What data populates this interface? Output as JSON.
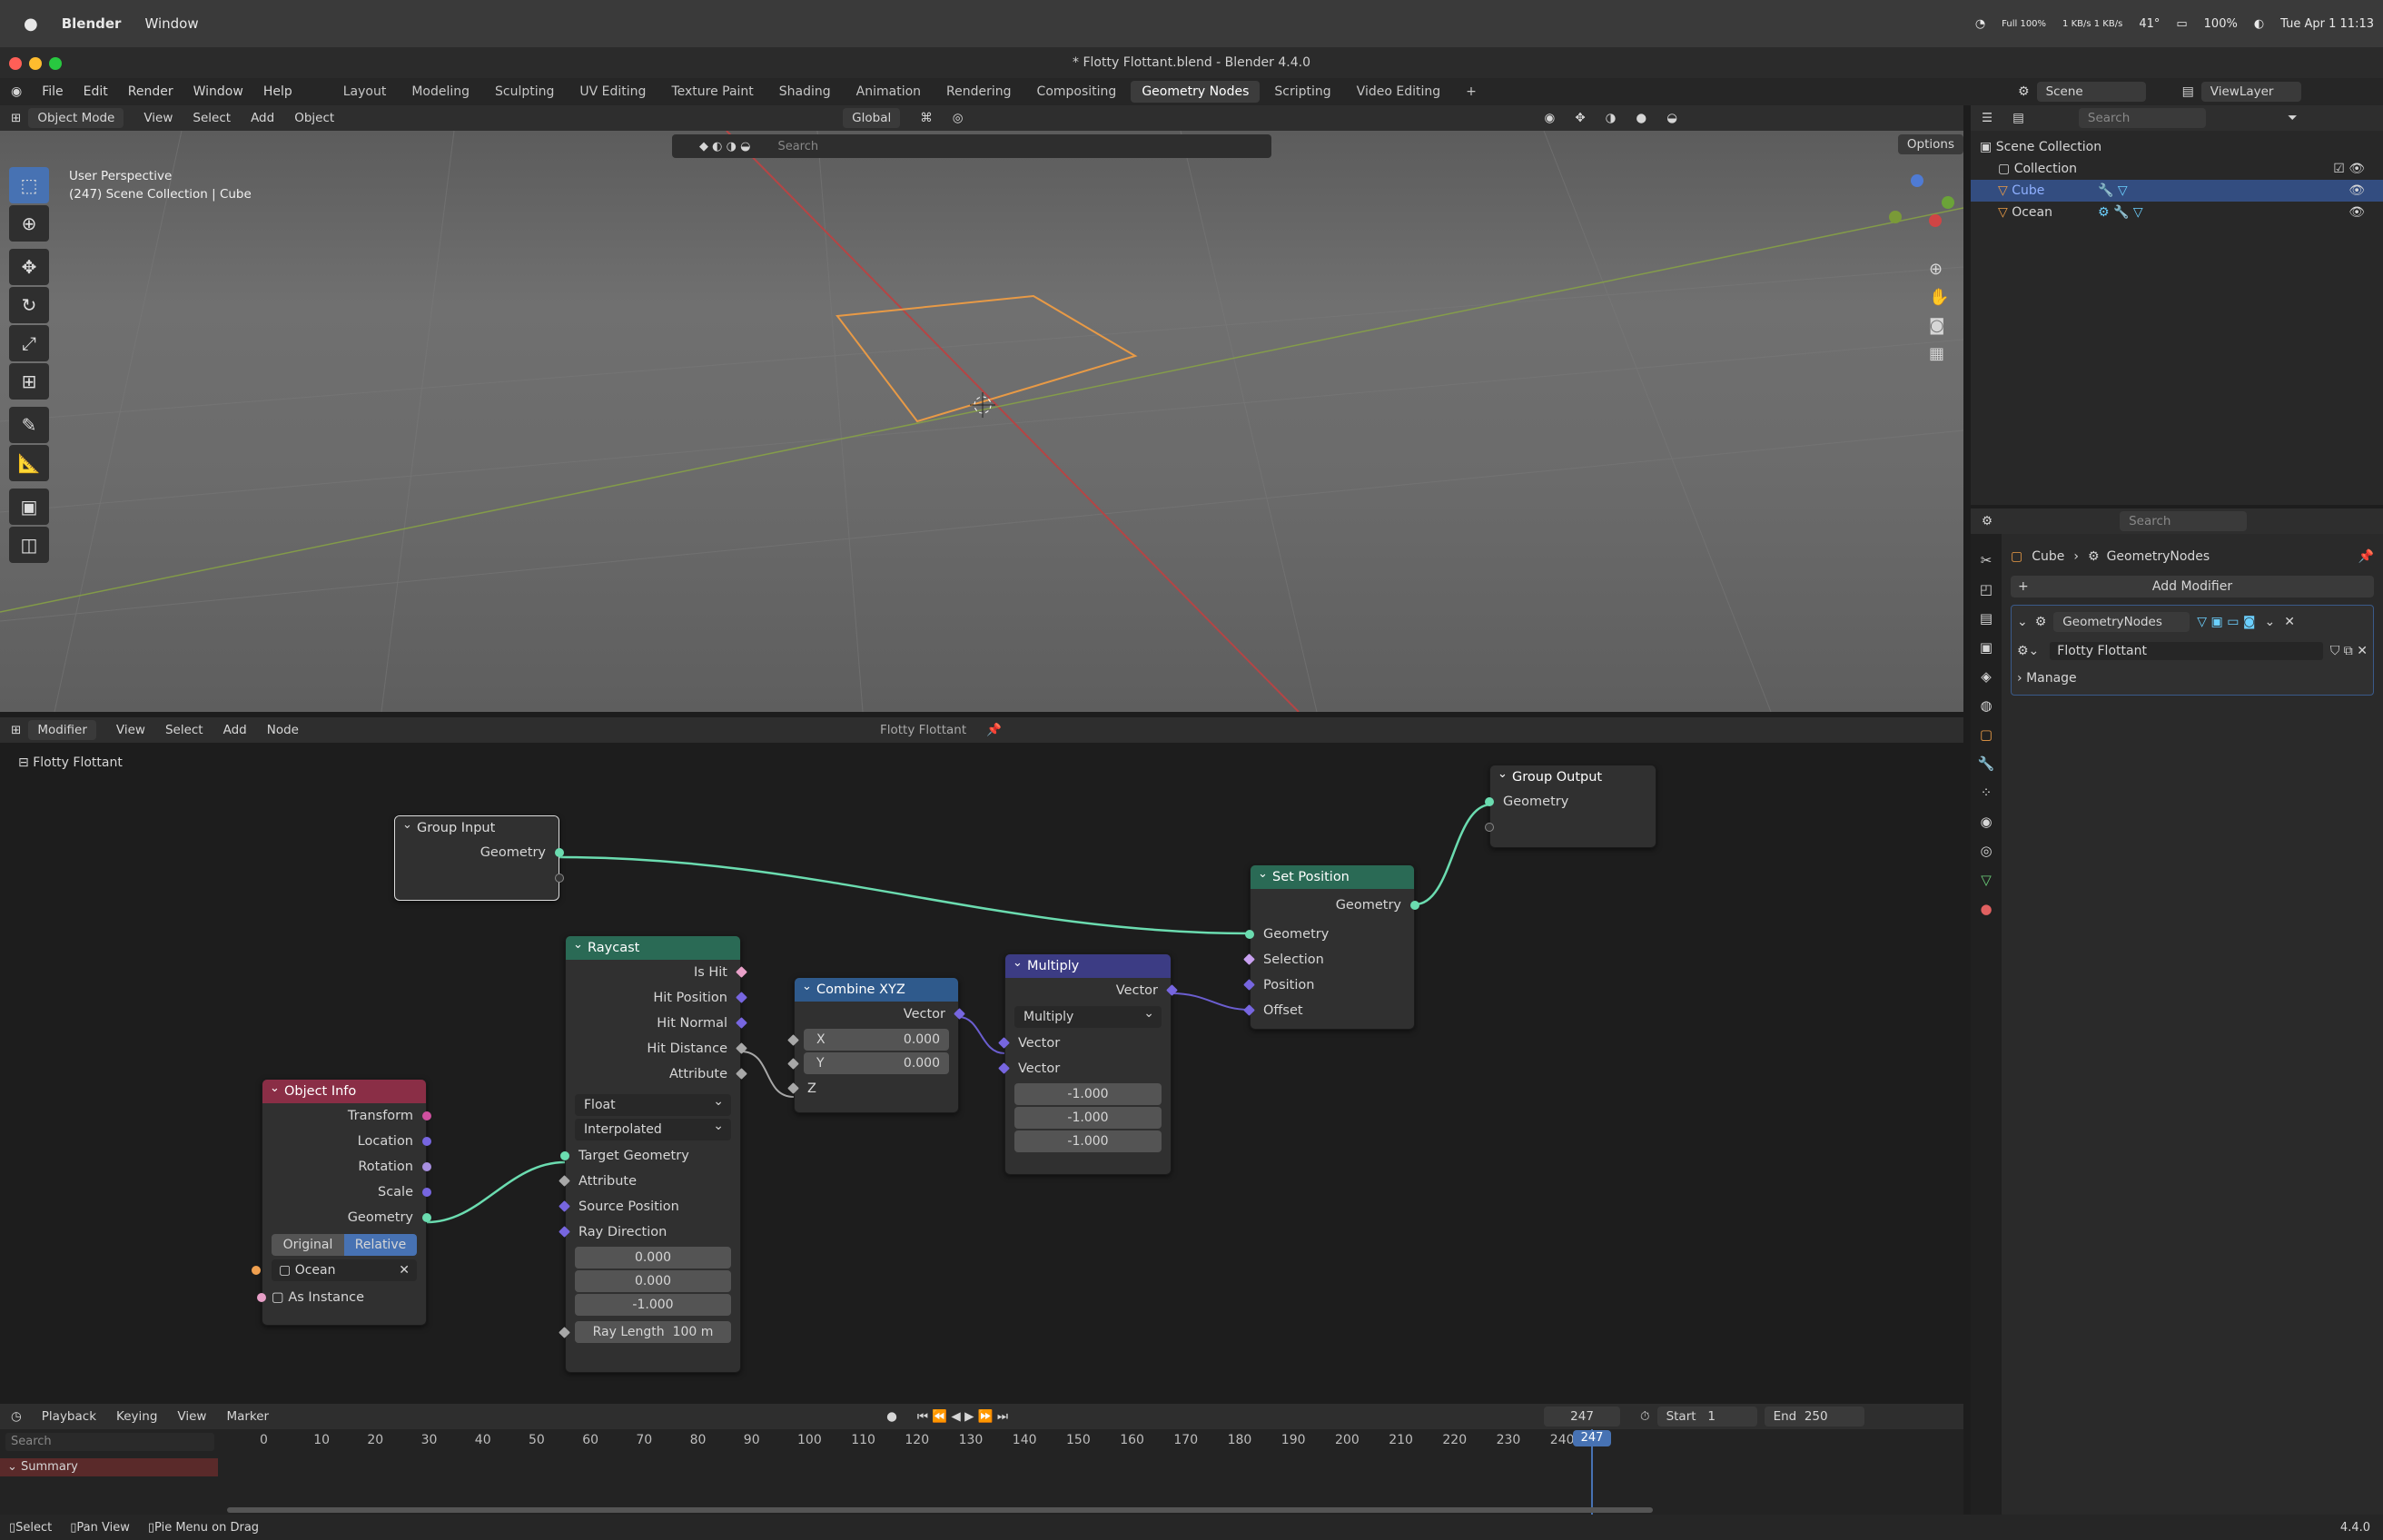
{
  "mac": {
    "app": "Blender",
    "window": "Window",
    "tray": [
      "Full 100%",
      "1 KB/s 1 KB/s",
      "41°",
      "100%"
    ],
    "clock": "Tue Apr 1 11:13"
  },
  "title": "* Flotty Flottant.blend - Blender 4.4.0",
  "menus": [
    "File",
    "Edit",
    "Render",
    "Window",
    "Help"
  ],
  "workspaces": [
    "Layout",
    "Modeling",
    "Sculpting",
    "UV Editing",
    "Texture Paint",
    "Shading",
    "Animation",
    "Rendering",
    "Compositing",
    "Geometry Nodes",
    "Scripting",
    "Video Editing"
  ],
  "active_workspace": "Geometry Nodes",
  "scene": {
    "label": "Scene",
    "viewlayer": "ViewLayer"
  },
  "viewport": {
    "mode": "Object Mode",
    "menus": [
      "View",
      "Select",
      "Add",
      "Object"
    ],
    "transform": "Global",
    "search_placeholder": "Search",
    "options": "Options",
    "info_line1": "User Perspective",
    "info_line2": "(247) Scene Collection | Cube"
  },
  "outliner": {
    "search_placeholder": "Search",
    "root": "Scene Collection",
    "items": [
      "Collection",
      "Cube",
      "Ocean"
    ]
  },
  "properties": {
    "search_placeholder": "Search",
    "breadcrumb_obj": "Cube",
    "breadcrumb_mod": "GeometryNodes",
    "add_modifier": "Add Modifier",
    "modifier_name": "GeometryNodes",
    "nodegroup": "Flotty Flottant",
    "manage": "Manage"
  },
  "node_editor": {
    "header_menus": [
      "Modifier",
      "View",
      "Select",
      "Add",
      "Node"
    ],
    "group_name": "Flotty Flottant",
    "breadcrumb": "Flotty Flottant"
  },
  "nodes": {
    "group_input": {
      "title": "Group Input",
      "out": "Geometry"
    },
    "group_output": {
      "title": "Group Output",
      "in": "Geometry"
    },
    "set_position": {
      "title": "Set Position",
      "out": "Geometry",
      "ins": [
        "Geometry",
        "Selection",
        "Position",
        "Offset"
      ]
    },
    "raycast": {
      "title": "Raycast",
      "outs": [
        "Is Hit",
        "Hit Position",
        "Hit Normal",
        "Hit Distance",
        "Attribute"
      ],
      "type": "Float",
      "mode": "Interpolated",
      "ins": [
        "Target Geometry",
        "Attribute",
        "Source Position",
        "Ray Direction"
      ],
      "dir": [
        "0.000",
        "0.000",
        "-1.000"
      ],
      "ray_length_label": "Ray Length",
      "ray_length": "100 m"
    },
    "combine": {
      "title": "Combine XYZ",
      "out": "Vector",
      "x_label": "X",
      "x": "0.000",
      "y_label": "Y",
      "y": "0.000",
      "z": "Z"
    },
    "multiply": {
      "title": "Multiply",
      "out": "Vector",
      "op": "Multiply",
      "ins": [
        "Vector",
        "Vector"
      ],
      "vals": [
        "-1.000",
        "-1.000",
        "-1.000"
      ]
    },
    "object_info": {
      "title": "Object Info",
      "outs": [
        "Transform",
        "Location",
        "Rotation",
        "Scale",
        "Geometry"
      ],
      "original": "Original",
      "relative": "Relative",
      "object": "Ocean",
      "as_instance": "As Instance"
    }
  },
  "timeline": {
    "menus": [
      "Playback",
      "Keying",
      "View",
      "Marker"
    ],
    "frame": "247",
    "start_label": "Start",
    "start": "1",
    "end_label": "End",
    "end": "250",
    "search_placeholder": "Search",
    "summary": "Summary",
    "ticks": [
      "0",
      "10",
      "20",
      "30",
      "40",
      "50",
      "60",
      "70",
      "80",
      "90",
      "100",
      "110",
      "120",
      "130",
      "140",
      "150",
      "160",
      "170",
      "180",
      "190",
      "200",
      "210",
      "220",
      "230",
      "240"
    ],
    "current": "247"
  },
  "status": {
    "select": "Select",
    "pan": "Pan View",
    "pie": "Pie Menu on Drag",
    "version": "4.4.0"
  }
}
